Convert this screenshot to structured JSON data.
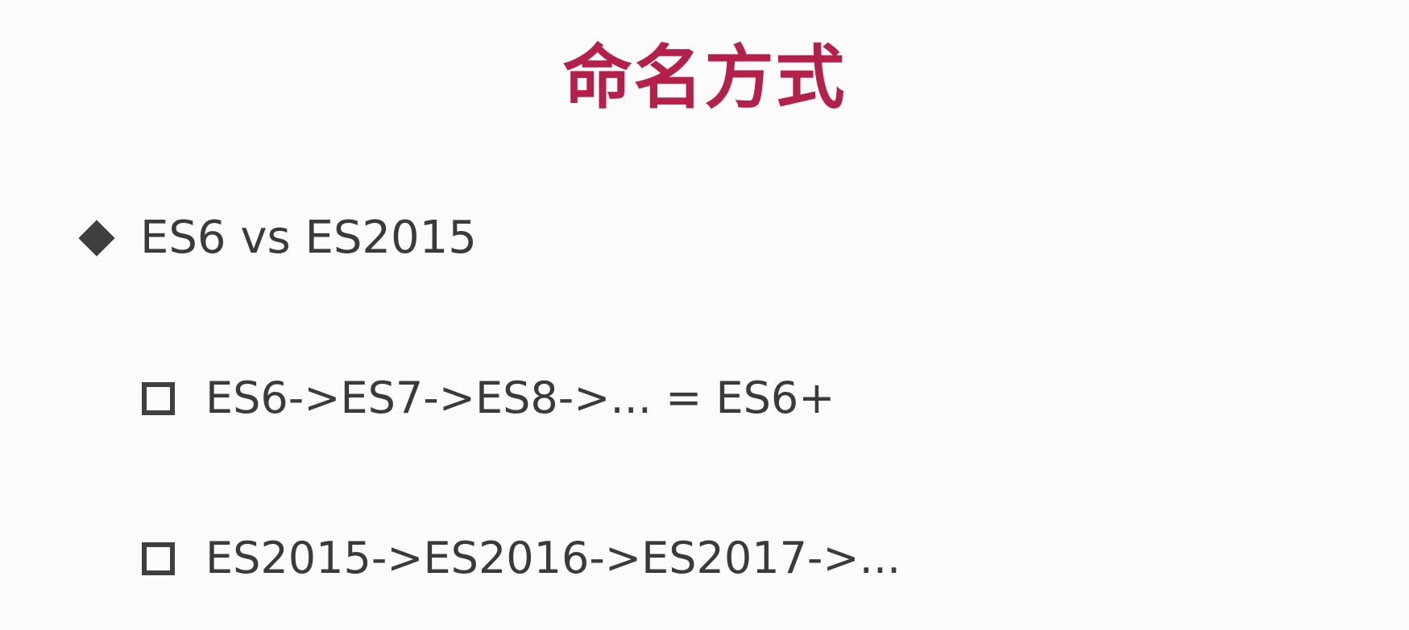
{
  "slide": {
    "title": "命名方式",
    "bullets": [
      {
        "level": 1,
        "marker": "diamond-icon",
        "text": "ES6 vs ES2015"
      },
      {
        "level": 2,
        "marker": "square-icon",
        "text": "ES6->ES7->ES8->... = ES6+"
      },
      {
        "level": 2,
        "marker": "square-icon",
        "text": "ES2015->ES2016->ES2017->..."
      }
    ]
  },
  "colors": {
    "title": "#b5204b",
    "text": "#3a3a3a",
    "background": "#fbfbfb"
  }
}
